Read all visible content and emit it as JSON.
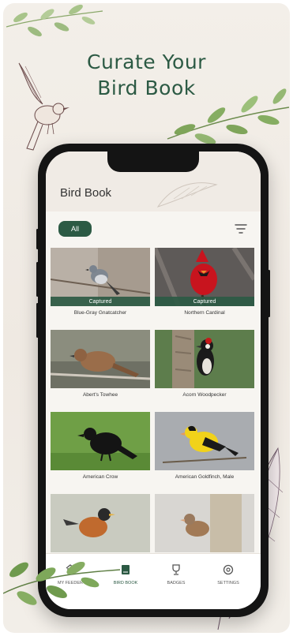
{
  "promo": {
    "headline_line1": "Curate Your",
    "headline_line2": "Bird Book"
  },
  "app": {
    "title": "Bird Book",
    "filter_chip": "All",
    "birds": [
      {
        "name": "Blue-Gray Gnatcatcher",
        "badge": "Captured"
      },
      {
        "name": "Northern Cardinal",
        "badge": "Captured"
      },
      {
        "name": "Abert's Towhee",
        "badge": ""
      },
      {
        "name": "Acorn Woodpecker",
        "badge": ""
      },
      {
        "name": "American Crow",
        "badge": ""
      },
      {
        "name": "American Goldfinch, Male",
        "badge": ""
      },
      {
        "name": "",
        "badge": ""
      },
      {
        "name": "",
        "badge": ""
      }
    ],
    "nav": [
      {
        "label": "MY FEEDER",
        "icon": "feeder-icon",
        "active": false
      },
      {
        "label": "BIRD BOOK",
        "icon": "book-icon",
        "active": true
      },
      {
        "label": "BADGES",
        "icon": "trophy-icon",
        "active": false
      },
      {
        "label": "SETTINGS",
        "icon": "gear-icon",
        "active": false
      }
    ]
  },
  "colors": {
    "accent": "#2c5a44",
    "background": "#efe9e2",
    "phone": "#141414"
  }
}
